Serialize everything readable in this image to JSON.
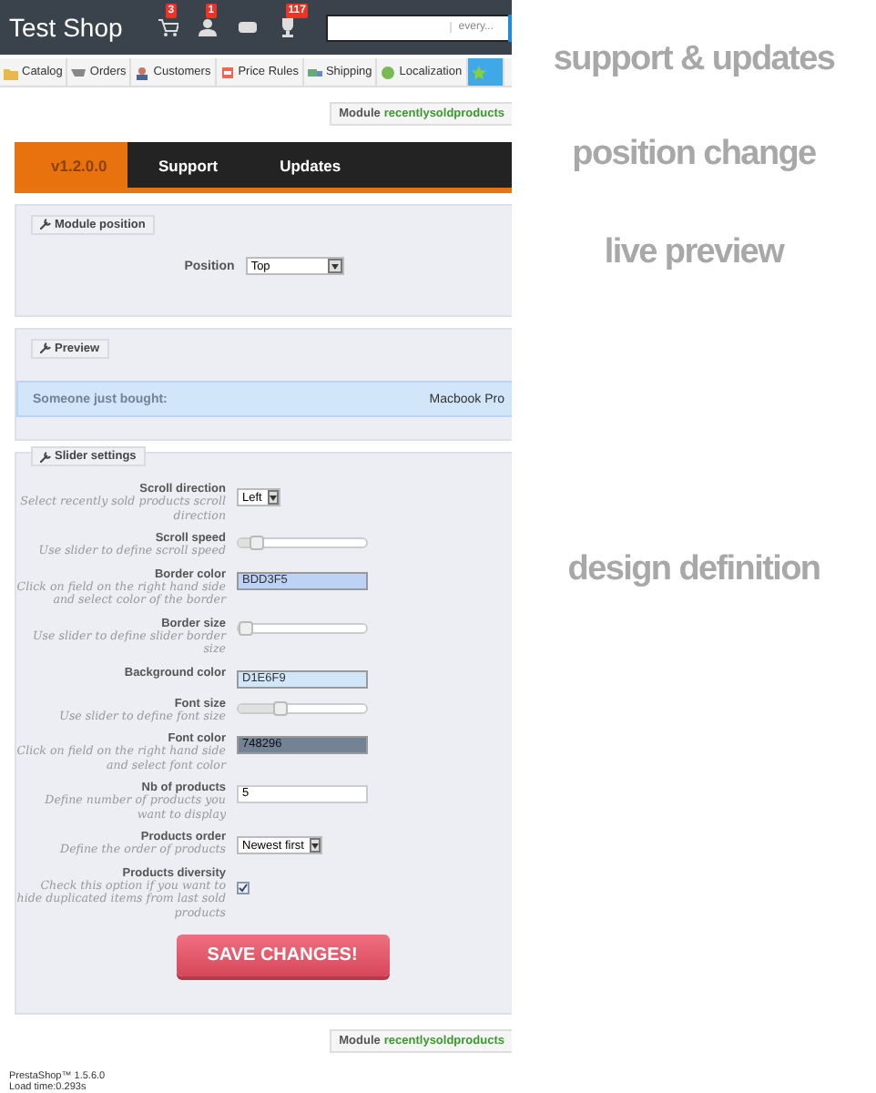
{
  "header": {
    "title": "Test Shop",
    "notifications": [
      {
        "count": "3"
      },
      {
        "count": "1"
      },
      {
        "count": "117"
      }
    ],
    "search_scope": "every..."
  },
  "nav": [
    {
      "label": "Catalog",
      "selected": false
    },
    {
      "label": "Orders",
      "selected": false
    },
    {
      "label": "Customers",
      "selected": false
    },
    {
      "label": "Price Rules",
      "selected": false
    },
    {
      "label": "Shipping",
      "selected": false
    },
    {
      "label": "Localization",
      "selected": false
    },
    {
      "selected": true
    }
  ],
  "module_badge_top": {
    "prefix": "Module",
    "name": "recentlysoldproducts"
  },
  "tabs": [
    {
      "label": "v1.2.0.0",
      "selected": true
    },
    {
      "label": "Support",
      "selected": false
    },
    {
      "label": "Updates",
      "selected": false
    }
  ],
  "position_panel": {
    "legend": "Module position",
    "label": "Position",
    "value": "Top"
  },
  "preview_panel": {
    "legend": "Preview",
    "text": "Someone just bought:",
    "product": "Macbook Pro"
  },
  "slider_panel": {
    "legend": "Slider settings",
    "fields": [
      {
        "kind": "select",
        "label": "Scroll direction",
        "help": "Select recently sold products scroll direction",
        "value": "Left"
      },
      {
        "kind": "slider",
        "label": "Scroll speed",
        "help": "Use slider to define scroll speed",
        "level": 0.1
      },
      {
        "kind": "color",
        "label": "Border color",
        "help": "Click on field on the right hand side and select color of the border",
        "value": "BDD3F5",
        "color": "#bdd3f5"
      },
      {
        "kind": "slider",
        "label": "Border size",
        "help": "Use slider to define slider border size",
        "level": 0.0
      },
      {
        "kind": "color",
        "label": "Background color",
        "value": "D1E6F9",
        "color": "#d1e6f9"
      },
      {
        "kind": "slider",
        "label": "Font size",
        "help": "Use slider to define font size",
        "level": 0.3
      },
      {
        "kind": "color",
        "label": "Font color",
        "help": "Click on field on the right hand side and select font color",
        "value": "748296",
        "color": "#748296"
      },
      {
        "kind": "text",
        "label": "Nb of products",
        "help": "Define number of products you want to display",
        "value": "5"
      },
      {
        "kind": "select",
        "label": "Products order",
        "help": "Define the order of products",
        "value": "Newest first"
      },
      {
        "kind": "checkbox",
        "label": "Products diversity",
        "help": "Check this option if you want to hide duplicated items from last sold products",
        "checked": true
      }
    ],
    "save": "SAVE CHANGES!"
  },
  "module_badge_bottom": {
    "prefix": "Module",
    "name": "recentlysoldproducts"
  },
  "footer": {
    "version": "PrestaShop™ 1.5.6.0",
    "load_time": "Load time:0.293s"
  },
  "captions": [
    "support & updates",
    "position change",
    "live preview",
    "design definition"
  ]
}
